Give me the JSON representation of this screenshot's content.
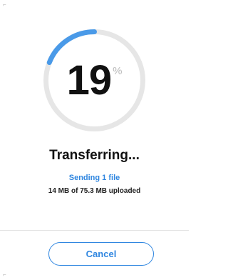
{
  "progress": {
    "percent_value": "19",
    "percent_fraction": 0.19,
    "percent_sign": "%"
  },
  "status": {
    "title": "Transferring...",
    "subtitle": "Sending 1 file",
    "detail": "14 MB of 75.3 MB uploaded"
  },
  "actions": {
    "cancel_label": "Cancel"
  },
  "colors": {
    "accent": "#2f86e0",
    "track": "#e6e6e6",
    "progress": "#4a9ae8"
  },
  "icons": {
    "top_corner": "corner-mark-icon",
    "bottom_corner": "corner-mark-icon"
  }
}
